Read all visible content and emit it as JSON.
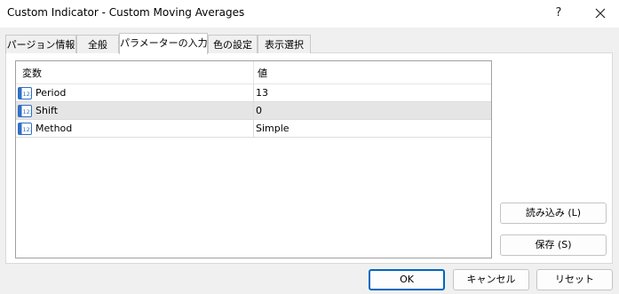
{
  "window": {
    "title": "Custom Indicator - Custom Moving Averages",
    "help_label": "?"
  },
  "tabs": [
    {
      "label": "パージョン情報"
    },
    {
      "label": "全般"
    },
    {
      "label": "パラメーターの入力",
      "active": true
    },
    {
      "label": "色の設定"
    },
    {
      "label": "表示選択"
    }
  ],
  "table": {
    "headers": {
      "variable": "変数",
      "value": "値"
    },
    "rows": [
      {
        "name": "Period",
        "value": "13",
        "icon": "number-param-icon"
      },
      {
        "name": "Shift",
        "value": "0",
        "icon": "number-param-icon",
        "selected": true
      },
      {
        "name": "Method",
        "value": "Simple",
        "icon": "number-param-icon"
      }
    ]
  },
  "side_buttons": {
    "load_label": "読み込み (L)",
    "save_label": "保存 (S)"
  },
  "footer": {
    "ok_label": "OK",
    "cancel_label": "キャンセル",
    "reset_label": "リセット"
  },
  "colors": {
    "accent": "#0067c0",
    "selected_row": "#e5e5e5",
    "icon_blue": "#2f6fc7"
  }
}
